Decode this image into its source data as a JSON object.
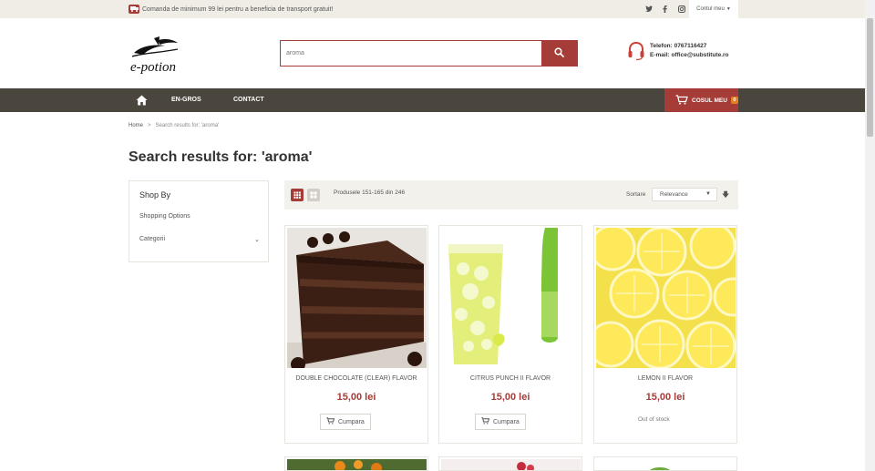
{
  "topbar": {
    "promo_text": "Comanda de minimum 99 lei pentru a beneficia de transport gratuit!",
    "social": [
      "twitter-icon",
      "facebook-icon",
      "instagram-icon"
    ],
    "account_label": "Contul meu"
  },
  "header": {
    "logo_text": "e-potion",
    "search": {
      "value": "aroma",
      "placeholder": ""
    },
    "contact": {
      "phone_label": "Telefon:",
      "phone": "0767116427",
      "email_label": "E-mail:",
      "email": "office@substitute.ro"
    }
  },
  "nav": {
    "items": [
      "EN-GROS",
      "CONTACT"
    ],
    "cart_label": "COSUL MEU",
    "cart_count": "0"
  },
  "breadcrumb": {
    "home": "Home",
    "separator": ">",
    "current": "Search results for: 'aroma'"
  },
  "page_title": "Search results for: 'aroma'",
  "sidebar": {
    "title": "Shop By",
    "options": "Shopping Options",
    "category": "Categorii"
  },
  "toolbar": {
    "count_text": "Produsele 151-165 din 246",
    "sort_label": "Sortare",
    "sort_value": "Relevance"
  },
  "products": [
    {
      "name": "DOUBLE CHOCOLATE (CLEAR) FLAVOR",
      "price": "15,00 lei",
      "action": "Cumpara",
      "in_stock": true
    },
    {
      "name": "CITRUS PUNCH II FLAVOR",
      "price": "15,00 lei",
      "action": "Cumpara",
      "in_stock": true
    },
    {
      "name": "LEMON II FLAVOR",
      "price": "15,00 lei",
      "status": "Out of stock",
      "in_stock": false
    }
  ],
  "colors": {
    "accent": "#a63c37",
    "nav_bg": "#4a463d",
    "topbar_bg": "#f0ede7",
    "badge": "#e67e22"
  }
}
